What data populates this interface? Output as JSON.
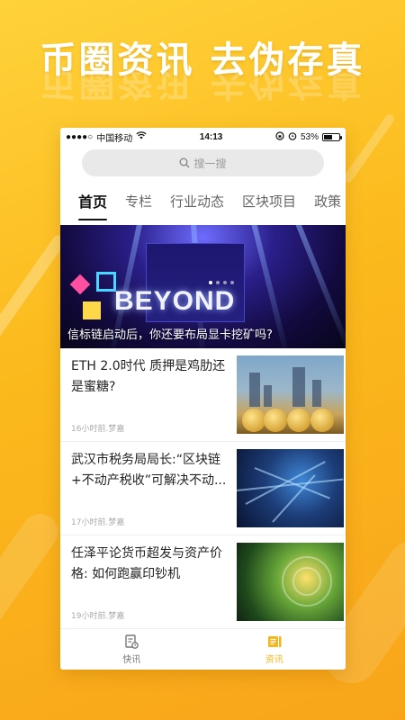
{
  "promo": {
    "headline": "币圈资讯  去伪存真"
  },
  "statusbar": {
    "signal": "●●●●○",
    "carrier": "中国移动",
    "wifi_icon": "wifi-icon",
    "time": "14:13",
    "battery": "53%"
  },
  "search": {
    "placeholder": "搜一搜",
    "icon": "search-icon"
  },
  "tabs": [
    {
      "label": "首页",
      "active": true
    },
    {
      "label": "专栏",
      "active": false
    },
    {
      "label": "行业动态",
      "active": false
    },
    {
      "label": "区块项目",
      "active": false
    },
    {
      "label": "政策",
      "active": false
    }
  ],
  "banner": {
    "caption": "信标链启动后，你还要布局显卡挖矿吗?",
    "stage_text": "BEYOND"
  },
  "articles": [
    {
      "title": "ETH 2.0时代 质押是鸡肋还是蜜糖?",
      "meta": "16小时前.梦嘉"
    },
    {
      "title": "武汉市税务局局长:“区块链+不动产税收”可解决不动...",
      "meta": "17小时前.梦嘉"
    },
    {
      "title": "任泽平论货币超发与资产价格: 如何跑赢印钞机",
      "meta": "19小时前.梦嘉"
    }
  ],
  "bottom_nav": [
    {
      "label": "快讯",
      "icon": "news-flash-icon",
      "active": false
    },
    {
      "label": "资讯",
      "icon": "articles-icon",
      "active": true
    }
  ],
  "colors": {
    "accent": "#f5b51b",
    "background": "#fbb91c"
  }
}
